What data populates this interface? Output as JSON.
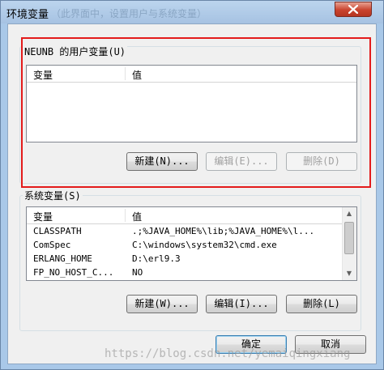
{
  "window": {
    "title": "环境变量",
    "title_ghost": "（此界面中，设置用户与系统变量）",
    "close_icon": "close-icon"
  },
  "user_vars": {
    "group_label": "NEUNB 的用户变量(U)",
    "columns": [
      "变量",
      "值"
    ],
    "rows": [],
    "buttons": {
      "new": "新建(N)...",
      "edit": "编辑(E)...",
      "delete": "删除(D)"
    },
    "highlight_color": "#e31b1b"
  },
  "system_vars": {
    "group_label": "系统变量(S)",
    "columns": [
      "变量",
      "值"
    ],
    "rows": [
      {
        "name": "CLASSPATH",
        "value": ".;%JAVA_HOME%\\lib;%JAVA_HOME%\\l..."
      },
      {
        "name": "ComSpec",
        "value": "C:\\windows\\system32\\cmd.exe"
      },
      {
        "name": "ERLANG_HOME",
        "value": "D:\\erl9.3"
      },
      {
        "name": "FP_NO_HOST_C...",
        "value": "NO"
      }
    ],
    "buttons": {
      "new": "新建(W)...",
      "edit": "编辑(I)...",
      "delete": "删除(L)"
    }
  },
  "footer": {
    "ok": "确定",
    "cancel": "取消",
    "watermark": "https://blog.csdn.net/yemaiqingxiang"
  }
}
